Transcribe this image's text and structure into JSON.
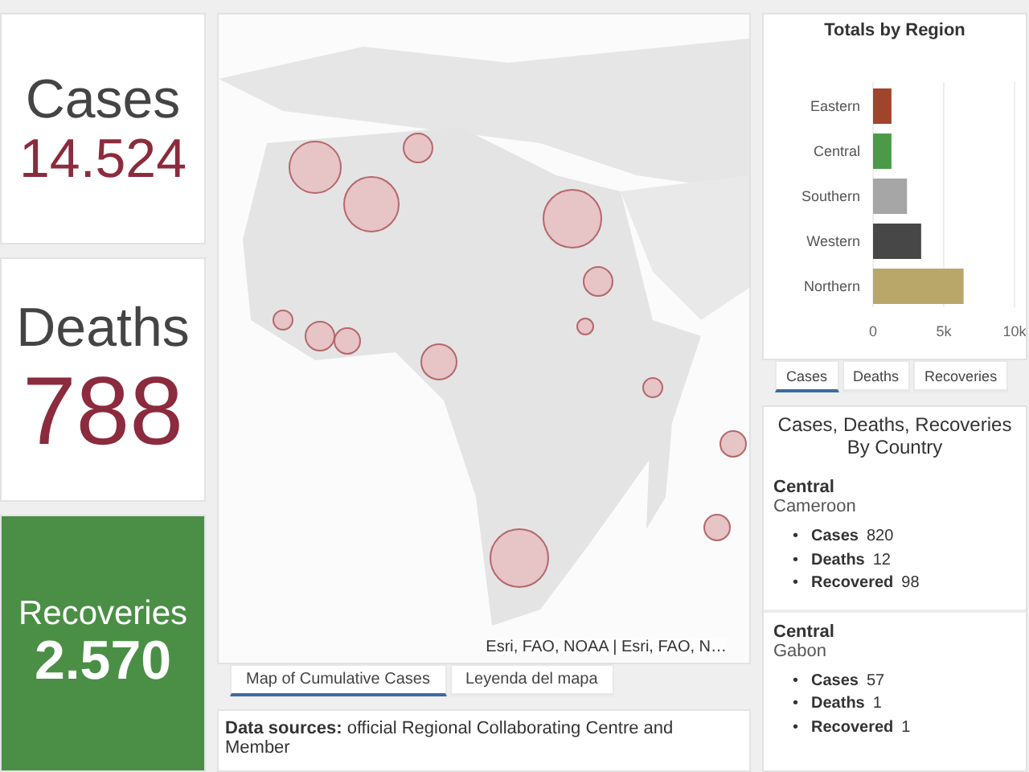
{
  "stats": [
    {
      "kind": "plain",
      "label": "Cases",
      "value": "14.524"
    },
    {
      "kind": "plain",
      "label": "Deaths",
      "value": "788"
    },
    {
      "kind": "filled",
      "label": "Recoveries",
      "value": "2.570"
    }
  ],
  "map": {
    "kind": "picture",
    "attribution": "Esri, FAO, NOAA | Esri, FAO, N…",
    "tabs": [
      {
        "label": "Map of Cumulative Cases",
        "selected": true
      },
      {
        "label": "Leyenda del mapa",
        "selected": false
      }
    ]
  },
  "sources": {
    "text": "**Data sources:** official Regional Collaborating Centre and Member"
  },
  "region_chart": {
    "title": "Totals by Region",
    "chart_data": {
      "type": "bar",
      "orientation": "horizontal",
      "categories": [
        "Eastern",
        "Central",
        "Southern",
        "Western",
        "Northern"
      ],
      "series": [
        {
          "color": "#a0452b",
          "values": [
            1300,
            null,
            null,
            null,
            null
          ]
        },
        {
          "color": "#4c9a48",
          "values": [
            null,
            1300,
            null,
            null,
            null
          ]
        },
        {
          "color": "#a6a6a6",
          "values": [
            null,
            null,
            2400,
            null,
            null
          ]
        },
        {
          "color": "#474747",
          "values": [
            null,
            null,
            null,
            3400,
            null
          ]
        },
        {
          "color": "#b9a76a",
          "values": [
            null,
            null,
            null,
            null,
            6400
          ]
        }
      ],
      "xlim": [
        0,
        10000
      ],
      "xticks": [
        {
          "value": 0,
          "label": "0"
        },
        {
          "value": 5000,
          "label": "5k"
        },
        {
          "value": 10000,
          "label": "10k"
        }
      ]
    },
    "tabs": [
      {
        "label": "Cases",
        "selected": true
      },
      {
        "label": "Deaths",
        "selected": false
      },
      {
        "label": "Recoveries",
        "selected": false
      }
    ]
  },
  "country_list": {
    "marker": "•",
    "title": "Cases, Deaths, Recoveries By Country",
    "items": [
      {
        "region": "Central",
        "country": "Cameroon",
        "stats": [
          {
            "label": "Cases",
            "value": "820"
          },
          {
            "label": "Deaths",
            "value": "12"
          },
          {
            "label": "Recovered",
            "value": "98"
          }
        ]
      },
      {
        "region": "Central",
        "country": "Gabon",
        "stats": [
          {
            "label": "Cases",
            "value": "57"
          },
          {
            "label": "Deaths",
            "value": "1"
          },
          {
            "label": "Recovered",
            "value": "1"
          }
        ]
      }
    ]
  }
}
